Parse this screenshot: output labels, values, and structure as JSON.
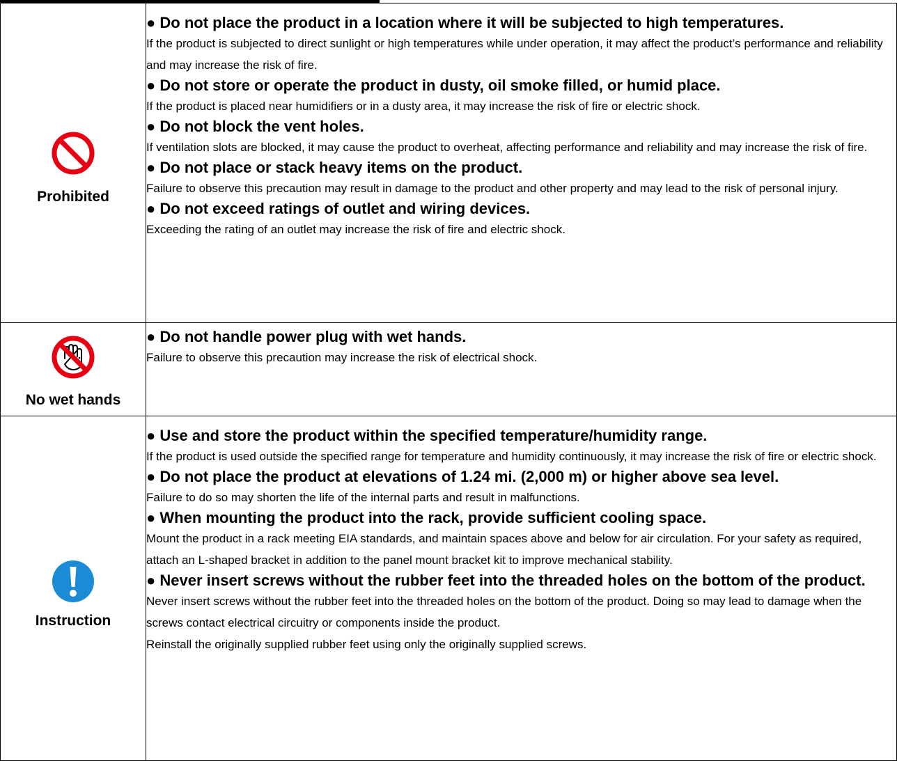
{
  "colors": {
    "prohibited_red": "#e60012",
    "instruction_blue": "#1a8bd4"
  },
  "sections": [
    {
      "icon": "prohibited-icon",
      "label": "Prohibited",
      "items": [
        {
          "heading": "● Do not place the product in a location where it will be subjected to high temperatures.",
          "body": "If the product is subjected to direct sunlight or high temperatures while under operation, it may affect the product’s performance and reliability and may increase the risk of fire."
        },
        {
          "heading": "● Do not store or operate the product in dusty, oil smoke filled, or humid place.",
          "body": "If the product is placed near humidifiers or in a dusty area, it may increase the risk of fire or electric shock."
        },
        {
          "heading": "● Do not block the vent holes.",
          "body": "If ventilation slots are blocked, it may cause the product to overheat, affecting performance and reliability and may increase the risk of fire."
        },
        {
          "heading": "● Do not place or stack heavy items on the product.",
          "body": "Failure to observe this precaution may result in damage to the product and other property and may lead to the risk of personal injury."
        },
        {
          "heading": "● Do not exceed ratings of outlet and wiring devices.",
          "body": "Exceeding the rating of an outlet may increase the risk of fire and electric shock."
        }
      ]
    },
    {
      "icon": "no-wet-hands-icon",
      "label": "No wet hands",
      "items": [
        {
          "heading": "● Do not handle power plug with wet hands.",
          "body": "Failure to observe this precaution may increase the risk of electrical shock."
        }
      ]
    },
    {
      "icon": "instruction-icon",
      "label": "Instruction",
      "items": [
        {
          "heading": "● Use and store the product within the specified temperature/humidity range.",
          "body": "If the product is used outside the specified range for temperature and humidity continuously, it may increase the risk of fire or electric shock."
        },
        {
          "heading": "● Do not place the product at elevations of 1.24 mi. (2,000 m) or higher above sea level.",
          "body": "Failure to do so may shorten the life of the internal parts and result in malfunctions."
        },
        {
          "heading": "● When mounting the product into the rack, provide sufficient cooling space.",
          "body": "Mount the product in a rack meeting EIA standards, and maintain spaces above and below for air circulation. For your safety as required, attach an L-shaped bracket in addition to the panel mount bracket kit to improve mechanical stability."
        },
        {
          "heading": "● Never insert screws without the rubber feet into the threaded holes on the bottom of the product.",
          "body": "Never insert screws without the rubber feet into the threaded holes on the bottom of the product. Doing so may lead to damage when the screws contact electrical circuitry or components inside the product.",
          "body2": "Reinstall the originally supplied rubber feet using only the originally supplied screws."
        }
      ]
    }
  ]
}
